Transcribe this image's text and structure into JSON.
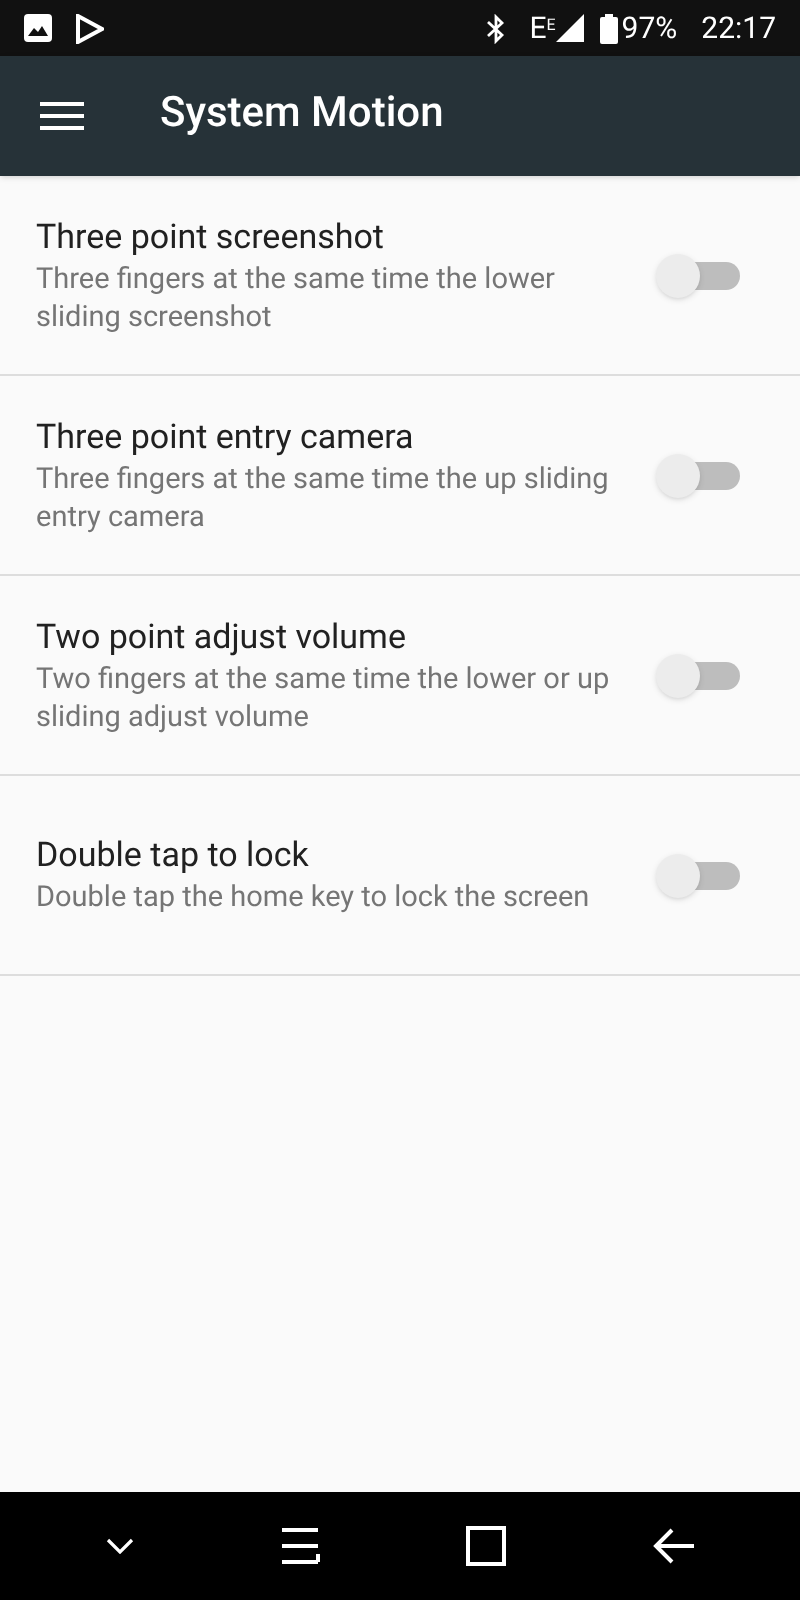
{
  "status_bar": {
    "network": "E",
    "network_small": "E",
    "battery": "97%",
    "time": "22:17"
  },
  "app_bar": {
    "title": "System Motion"
  },
  "settings": [
    {
      "title": "Three point screenshot",
      "summary": "Three fingers at the same time the lower sliding screenshot",
      "on": false
    },
    {
      "title": "Three point entry camera",
      "summary": "Three fingers at the same time the up sliding entry camera",
      "on": false
    },
    {
      "title": "Two point adjust volume",
      "summary": "Two fingers at the same time the lower or up sliding adjust volume",
      "on": false
    },
    {
      "title": "Double tap to lock",
      "summary": "Double tap the home key to lock the screen",
      "on": false
    }
  ]
}
